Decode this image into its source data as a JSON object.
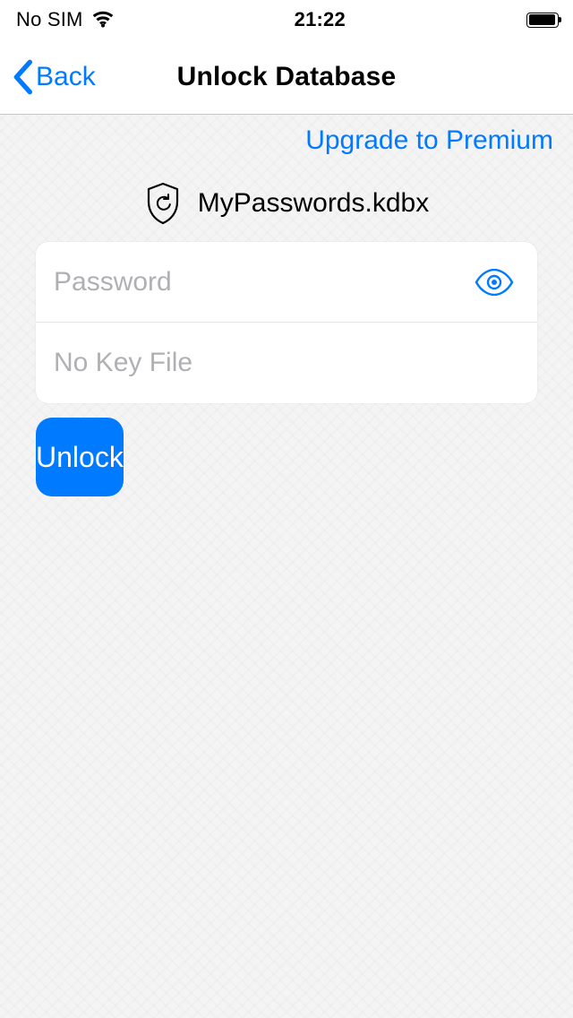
{
  "status_bar": {
    "carrier": "No SIM",
    "time": "21:22"
  },
  "nav": {
    "back_label": "Back",
    "title": "Unlock Database"
  },
  "upgrade_label": "Upgrade to Premium",
  "database": {
    "filename": "MyPasswords.kdbx"
  },
  "form": {
    "password_placeholder": "Password",
    "password_value": "",
    "keyfile_label": "No Key File",
    "unlock_label": "Unlock"
  },
  "colors": {
    "accent": "#007aff"
  }
}
